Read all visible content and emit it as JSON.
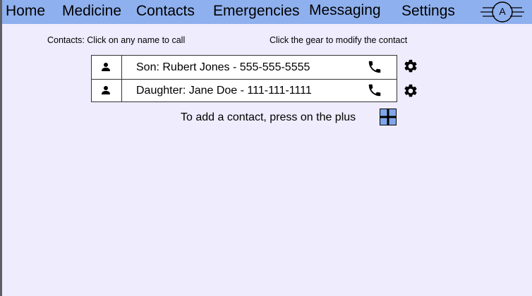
{
  "nav": {
    "items": [
      {
        "label": "Home"
      },
      {
        "label": "Medicine"
      },
      {
        "label": "Contacts"
      },
      {
        "label": "Emergencies"
      },
      {
        "label": "Messaging"
      },
      {
        "label": "Settings"
      }
    ],
    "avatar_letter": "A"
  },
  "hints": {
    "call": "Contacts: Click on any name to call",
    "modify": "Click the gear to modify the contact"
  },
  "contacts": [
    {
      "label": "Son: Rubert Jones - 555-555-5555",
      "icon": "person-icon",
      "action_icon": "phone-icon"
    },
    {
      "label": "Daughter: Jane Doe - 111-111-1111",
      "icon": "person-icon",
      "action_icon": "phone-icon"
    }
  ],
  "add_contact": {
    "text": "To add a contact, press on the plus",
    "icon": "plus-icon"
  },
  "colors": {
    "navbar": "#8fb0ee",
    "background": "#eeecfd",
    "plus_fill": "#7fa6e8"
  }
}
